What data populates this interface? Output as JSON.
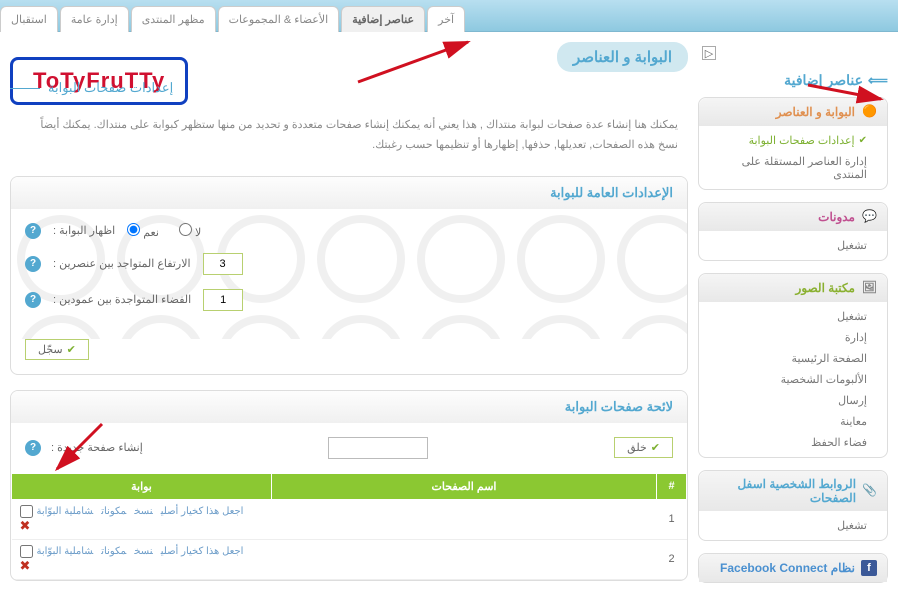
{
  "tabs": {
    "reception": "استقبال",
    "general_admin": "إدارة عامة",
    "forum_appearance": "مظهر المنتدى",
    "members_groups": "الأعضاء & المجموعات",
    "extra_elements": "عناصر إضافية",
    "other": "آخر"
  },
  "logo": "ToTyFruTTy",
  "sidebar": {
    "title": "عناصر إضافية",
    "box1": {
      "title": "البوابة و العناصر",
      "items": [
        "إعدادات صفحات البوابة",
        "إدارة العناصر المستقلة على المنتدى"
      ]
    },
    "box2": {
      "title": "مدونات",
      "items": [
        "تشغيل"
      ]
    },
    "box3": {
      "title": "مكتبة الصور",
      "items": [
        "تشغيل",
        "إدارة",
        "الصفحة الرئيسية",
        "الألبومات الشخصية",
        "إرسال",
        "معاينة",
        "فضاء الحفظ"
      ]
    },
    "box4": {
      "title": "الروابط الشخصية اسفل الصفحات",
      "items": [
        "تشغيل"
      ]
    },
    "box5": {
      "title": "نظام Facebook Connect"
    }
  },
  "page": {
    "title": "البوابة و العناصر",
    "subtitle": "إعدادات صفحات البوابة",
    "description": "يمكنك هنا إنشاء عدة صفحات لبوابة منتداك , هذا يعني أنه يمكنك إنشاء صفحات متعددة و تحديد من منها ستظهر كبوابة على منتداك. يمكنك أيضاً نسخ هذه الصفحات, تعديلها, حذفها, إظهارها أو تنظيمها حسب رغبتك."
  },
  "section1": {
    "title": "الإعدادات العامة للبوابة",
    "show_portal": "اظهار البوابة :",
    "yes": "نعم",
    "no": "لا",
    "height_between": "الارتفاع المتواجد بين عنصرين :",
    "height_val": "3",
    "space_between": "الفضاء المتواجدة بين عمودين :",
    "space_val": "1",
    "save": "سجّل"
  },
  "section2": {
    "title": "لائحة صفحات البوابة",
    "create_label": "إنشاء صفحة جديدة :",
    "create_btn": "خلق",
    "col_num": "#",
    "col_name": "اسم الصفحات",
    "col_portal": "بوابة",
    "rows": [
      {
        "num": "1",
        "name": "",
        "actions": [
          "اجعل هذا كخيار أصلي",
          "نسخ",
          "مكونات",
          "شاملية البوّابة"
        ]
      },
      {
        "num": "2",
        "name": "",
        "actions": [
          "اجعل هذا كخيار أصلي",
          "نسخ",
          "مكونات",
          "شاملية البوّابة"
        ]
      }
    ]
  }
}
